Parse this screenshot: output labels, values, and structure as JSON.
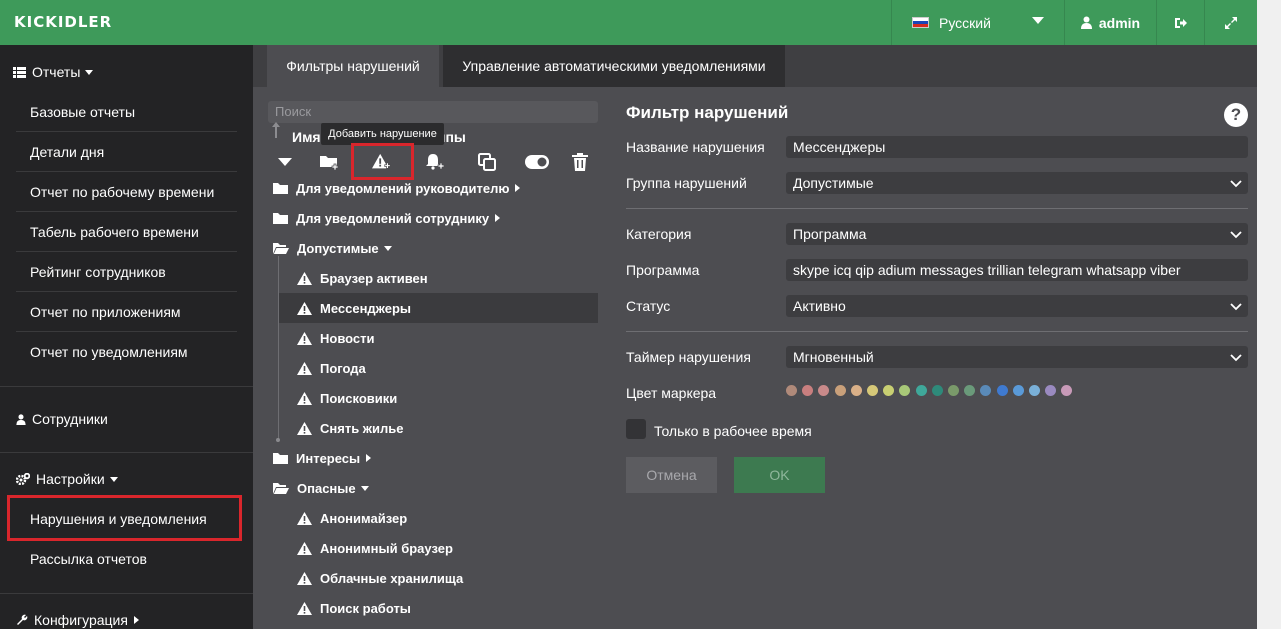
{
  "app": {
    "logo": "KICKIDLER",
    "language": "Русский",
    "user": "admin"
  },
  "sidebar": {
    "reports_header": "Отчеты",
    "report_items": [
      "Базовые отчеты",
      "Детали дня",
      "Отчет по рабочему времени",
      "Табель рабочего времени",
      "Рейтинг сотрудников",
      "Отчет по приложениям",
      "Отчет по уведомлениям"
    ],
    "employees": "Сотрудники",
    "settings_header": "Настройки",
    "settings_items": [
      "Нарушения и уведомления",
      "Рассылка отчетов"
    ],
    "config_header": "Конфигурация"
  },
  "tabs": [
    "Фильтры нарушений",
    "Управление автоматическими уведомлениями"
  ],
  "tree": {
    "search_placeholder": "Поиск",
    "header_left": "Имя",
    "header_right": "ппы",
    "tooltip": "Добавить нарушение",
    "rows": [
      {
        "label": "Для уведомлений руководителю",
        "type": "folder",
        "arrow": "right"
      },
      {
        "label": "Для уведомлений сотруднику",
        "type": "folder",
        "arrow": "right"
      },
      {
        "label": "Допустимые",
        "type": "folder-open",
        "arrow": "down"
      },
      {
        "label": "Браузер активен",
        "type": "item"
      },
      {
        "label": "Мессенджеры",
        "type": "item",
        "selected": true
      },
      {
        "label": "Новости",
        "type": "item"
      },
      {
        "label": "Погода",
        "type": "item"
      },
      {
        "label": "Поисковики",
        "type": "item"
      },
      {
        "label": "Снять жилье",
        "type": "item"
      },
      {
        "label": "Интересы",
        "type": "folder",
        "arrow": "right"
      },
      {
        "label": "Опасные",
        "type": "folder-open",
        "arrow": "down"
      },
      {
        "label": "Анонимайзер",
        "type": "item"
      },
      {
        "label": "Анонимный браузер",
        "type": "item"
      },
      {
        "label": "Облачные хранилища",
        "type": "item"
      },
      {
        "label": "Поиск работы",
        "type": "item"
      }
    ]
  },
  "filter": {
    "title": "Фильтр нарушений",
    "help": "?",
    "name_label": "Название нарушения",
    "name_value": "Мессенджеры",
    "group_label": "Группа нарушений",
    "group_value": "Допустимые",
    "category_label": "Категория",
    "category_value": "Программа",
    "program_label": "Программа",
    "program_value": "skype icq qip adium messages trillian telegram whatsapp viber",
    "status_label": "Статус",
    "status_value": "Активно",
    "timer_label": "Таймер нарушения",
    "timer_value": "Мгновенный",
    "color_label": "Цвет маркера",
    "colors": [
      "#b08a7a",
      "#c97f7f",
      "#c98a8a",
      "#c9a07a",
      "#d9b088",
      "#d6c878",
      "#c8cf72",
      "#a8c878",
      "#3fa89a",
      "#2e8a7a",
      "#7a9a6a",
      "#6a9a7a",
      "#5a8ab8",
      "#3f7ad0",
      "#5a9ad8",
      "#7ab0d8",
      "#9a8ac0",
      "#c89ab8"
    ],
    "worktime_label": "Только в рабочее время",
    "cancel_label": "Отмена",
    "ok_label": "OK"
  }
}
